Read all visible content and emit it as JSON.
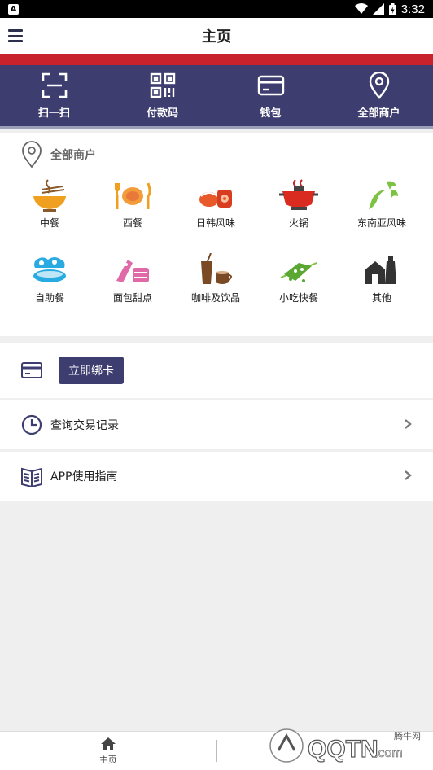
{
  "status": {
    "time": "3:32"
  },
  "header": {
    "title": "主页"
  },
  "quick_actions": [
    {
      "label": "扫一扫",
      "icon": "scan-icon"
    },
    {
      "label": "付款码",
      "icon": "qr-code-icon"
    },
    {
      "label": "钱包",
      "icon": "wallet-card-icon"
    },
    {
      "label": "全部商户",
      "icon": "location-pin-icon"
    }
  ],
  "merchants": {
    "title": "全部商户",
    "categories": [
      {
        "label": "中餐",
        "icon": "noodle-bowl-icon"
      },
      {
        "label": "西餐",
        "icon": "steak-cutlery-icon"
      },
      {
        "label": "日韩风味",
        "icon": "sushi-icon"
      },
      {
        "label": "火锅",
        "icon": "hotpot-icon"
      },
      {
        "label": "东南亚风味",
        "icon": "lobster-icon"
      },
      {
        "label": "自助餐",
        "icon": "buffet-plate-icon"
      },
      {
        "label": "面包甜点",
        "icon": "dessert-icon"
      },
      {
        "label": "咖啡及饮品",
        "icon": "coffee-drink-icon"
      },
      {
        "label": "小吃快餐",
        "icon": "skewer-snack-icon"
      },
      {
        "label": "其他",
        "icon": "misc-store-icon"
      }
    ]
  },
  "bind_card": {
    "button_label": "立即绑卡",
    "icon": "card-icon"
  },
  "links": [
    {
      "label": "查询交易记录",
      "icon": "clock-icon"
    },
    {
      "label": "APP使用指南",
      "icon": "guide-book-icon"
    }
  ],
  "bottom_nav": {
    "home_label": "主页"
  },
  "watermark": {
    "brand": "QQTN",
    "suffix": ".com",
    "cn": "腾牛网"
  },
  "colors": {
    "primary": "#3e3d70",
    "accent_red": "#c8232c"
  }
}
